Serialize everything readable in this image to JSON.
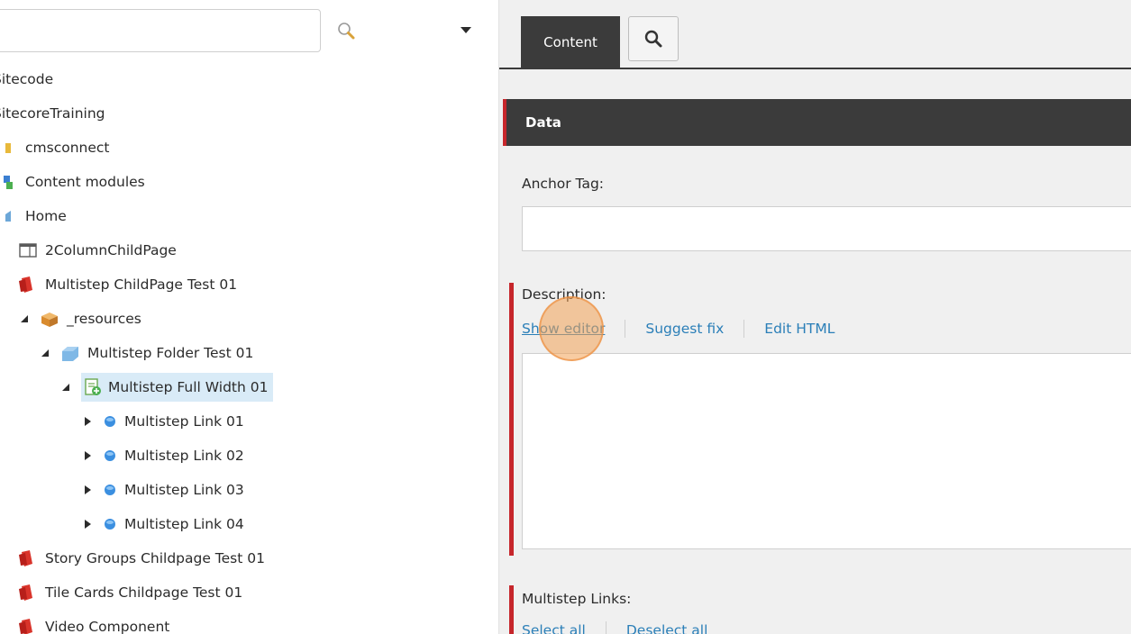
{
  "search": {
    "placeholder": "",
    "value": ""
  },
  "tree": {
    "items": [
      {
        "label": "Sitecode",
        "icon": "site-icon"
      },
      {
        "label": "SitecoreTraining",
        "icon": "site-icon"
      },
      {
        "label": "cmsconnect",
        "icon": "folder-icon"
      },
      {
        "label": "Content modules",
        "icon": "modules-icon"
      },
      {
        "label": "Home",
        "icon": "home-icon"
      },
      {
        "label": "2ColumnChildPage",
        "icon": "layout-icon"
      },
      {
        "label": "Multistep ChildPage Test 01",
        "icon": "red-page-icon"
      },
      {
        "label": "_resources",
        "icon": "box-icon"
      },
      {
        "label": "Multistep Folder Test 01",
        "icon": "blue-folder-icon"
      },
      {
        "label": "Multistep Full Width 01",
        "icon": "green-doc-icon"
      },
      {
        "label": "Multistep Link 01",
        "icon": "blue-dot-icon"
      },
      {
        "label": "Multistep Link 02",
        "icon": "blue-dot-icon"
      },
      {
        "label": "Multistep Link 03",
        "icon": "blue-dot-icon"
      },
      {
        "label": "Multistep Link 04",
        "icon": "blue-dot-icon"
      },
      {
        "label": "Story Groups Childpage Test 01",
        "icon": "red-page-icon"
      },
      {
        "label": "Tile Cards Childpage Test 01",
        "icon": "red-page-icon"
      },
      {
        "label": "Video Component",
        "icon": "red-page-icon"
      }
    ]
  },
  "tabs": {
    "content_label": "Content"
  },
  "section": {
    "title": "Data"
  },
  "fields": {
    "anchor_tag": {
      "label": "Anchor Tag:",
      "value": ""
    },
    "description": {
      "label": "Description:",
      "show_editor": "Show editor",
      "suggest_fix": "Suggest fix",
      "edit_html": "Edit HTML"
    },
    "multistep_links": {
      "label": "Multistep Links:",
      "select_all": "Select all",
      "deselect_all": "Deselect all"
    }
  },
  "colors": {
    "accent_red": "#c6262b",
    "link_blue": "#2b7fb8",
    "header_dark": "#3b3b3b",
    "selection_blue": "#d9ebf7"
  }
}
